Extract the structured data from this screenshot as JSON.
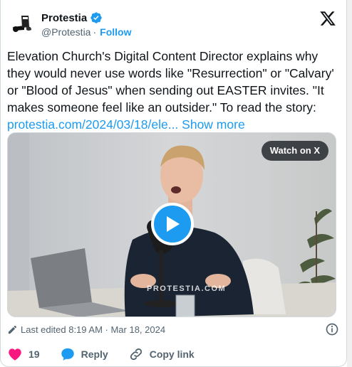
{
  "account": {
    "name": "Protestia",
    "handle": "@Protestia",
    "separator": "·",
    "follow_label": "Follow"
  },
  "tweet": {
    "text": "Elevation Church's Digital Content Director explains why they would never use words like \"Resurrection\" or \"Calvary' or \"Blood of Jesus\" when sending out EASTER invites. \"It makes someone feel like an outsider.\" To read the story: ",
    "link": "protestia.com/2024/03/18/ele...",
    "show_more": "Show more"
  },
  "media": {
    "watch_label": "Watch on X",
    "watermark": "PROTESTIA.COM"
  },
  "meta": {
    "edited": "Last edited 8:19 AM · Mar 18, 2024"
  },
  "actions": {
    "likes": "19",
    "reply_label": "Reply",
    "copy_label": "Copy link"
  },
  "colors": {
    "accent": "#1d9bf0",
    "heart": "#f91880",
    "text": "#0f1419",
    "muted": "#536471"
  }
}
